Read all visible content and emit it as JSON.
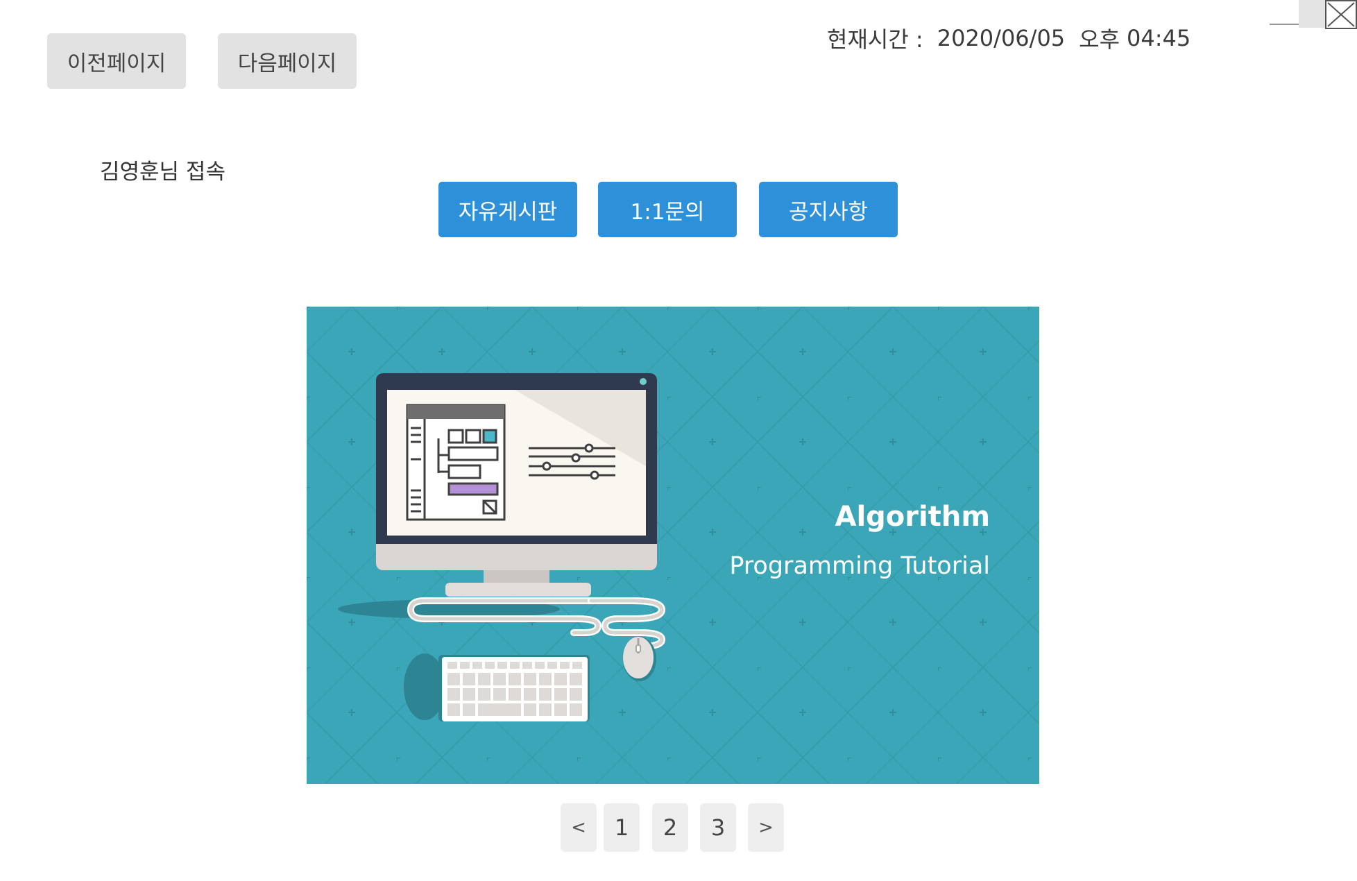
{
  "header": {
    "prev_page_label": "이전페이지",
    "next_page_label": "다음페이지",
    "clock_label": "현재시간 :",
    "clock_date": "2020/06/05",
    "clock_ampm": "오후",
    "clock_time": "04:45"
  },
  "user": {
    "status_text": "김영훈님 접속"
  },
  "menu": {
    "items": [
      {
        "label": "자유게시판"
      },
      {
        "label": "1:1문의"
      },
      {
        "label": "공지사항"
      }
    ]
  },
  "banner": {
    "title": "Algorithm",
    "subtitle": "Programming Tutorial",
    "background_color": "#3aa6b8",
    "icon": "desktop-computer-illustration"
  },
  "pagination": {
    "prev_label": "<",
    "next_label": ">",
    "pages": [
      "1",
      "2",
      "3"
    ]
  },
  "colors": {
    "primary_button": "#2e90d8",
    "secondary_button": "#e2e2e2",
    "pager_button": "#eeeeee"
  }
}
